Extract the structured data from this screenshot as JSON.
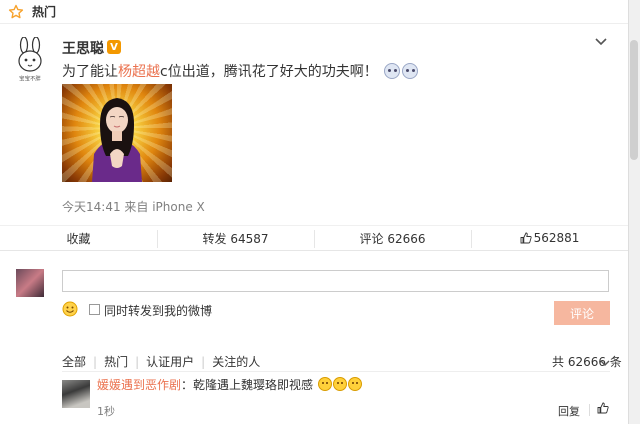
{
  "hotbar": {
    "label": "热门",
    "icon": "star-icon"
  },
  "post": {
    "username": "王思聪",
    "verified_badge": "V",
    "avatar_caption": "宝宝不胖",
    "text_before": "为了能让",
    "text_highlight": "杨超越",
    "text_after": "c位出道，腾讯花了好大的功夫啊！",
    "meta": "今天14:41 来自 iPhone X",
    "accent_color": "#eb7350"
  },
  "actions": {
    "favorite": "收藏",
    "repost": "转发 64587",
    "comment": "评论 62666",
    "like": "562881"
  },
  "composer": {
    "input_value": "",
    "placeholder": "",
    "checkbox_label": "同时转发到我的微博",
    "submit_label": "评论"
  },
  "filters": {
    "all": "全部",
    "hot": "热门",
    "verified": "认证用户",
    "following": "关注的人",
    "total": "共 62666 条"
  },
  "comments": [
    {
      "user": "媛媛遇到恶作剧",
      "text": "：乾隆遇上魏璎珞即视感",
      "time": "1秒",
      "reply": "回复"
    }
  ]
}
